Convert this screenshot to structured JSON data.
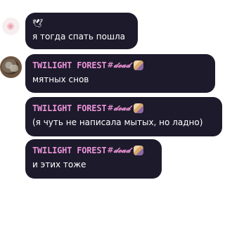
{
  "chat": {
    "messages": [
      {
        "prefix": "🕊",
        "text": "я тогда спать пошла"
      },
      {
        "username": "TWILIGHT FOREST",
        "tag": "#𝓭𝓮𝓪𝓭",
        "text": "мятных снов"
      },
      {
        "username": "TWILIGHT FOREST",
        "tag": "#𝓭𝓮𝓪𝓭",
        "text": "(я чуть не написала мытых, но ладно)"
      },
      {
        "username": "TWILIGHT FOREST",
        "tag": "#𝓭𝓮𝓪𝓭",
        "text": "и этих тоже"
      }
    ]
  }
}
